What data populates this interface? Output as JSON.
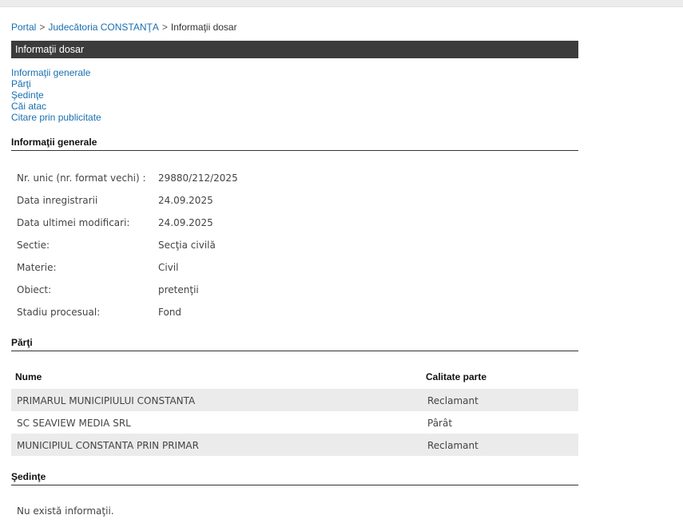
{
  "breadcrumb": {
    "portal": "Portal",
    "court": "Judecătoria CONSTANŢA",
    "current": "Informaţii dosar",
    "separator": ">"
  },
  "title": "Informaţii dosar",
  "nav": [
    "Informaţii generale",
    "Părţi",
    "Şedinţe",
    "Căi atac",
    "Citare prin publicitate"
  ],
  "general": {
    "heading": "Informaţii generale",
    "rows": [
      {
        "label": "Nr. unic (nr. format vechi) :",
        "value": "29880/212/2025"
      },
      {
        "label": "Data inregistrarii",
        "value": "24.09.2025"
      },
      {
        "label": "Data ultimei modificari:",
        "value": "24.09.2025"
      },
      {
        "label": "Sectie:",
        "value": "Secţia civilă"
      },
      {
        "label": "Materie:",
        "value": "Civil"
      },
      {
        "label": "Obiect:",
        "value": "pretenţii"
      },
      {
        "label": "Stadiu procesual:",
        "value": "Fond"
      }
    ]
  },
  "parti": {
    "heading": "Părţi",
    "columns": [
      "Nume",
      "Calitate parte"
    ],
    "rows": [
      {
        "name": "PRIMARUL MUNICIPIULUI CONSTANTA",
        "role": "Reclamant"
      },
      {
        "name": "SC SEAVIEW MEDIA SRL",
        "role": "Pârât"
      },
      {
        "name": "MUNICIPIUL CONSTANTA PRIN PRIMAR",
        "role": "Reclamant"
      }
    ]
  },
  "sedinte": {
    "heading": "Şedinţe",
    "empty": "Nu există informaţii."
  }
}
